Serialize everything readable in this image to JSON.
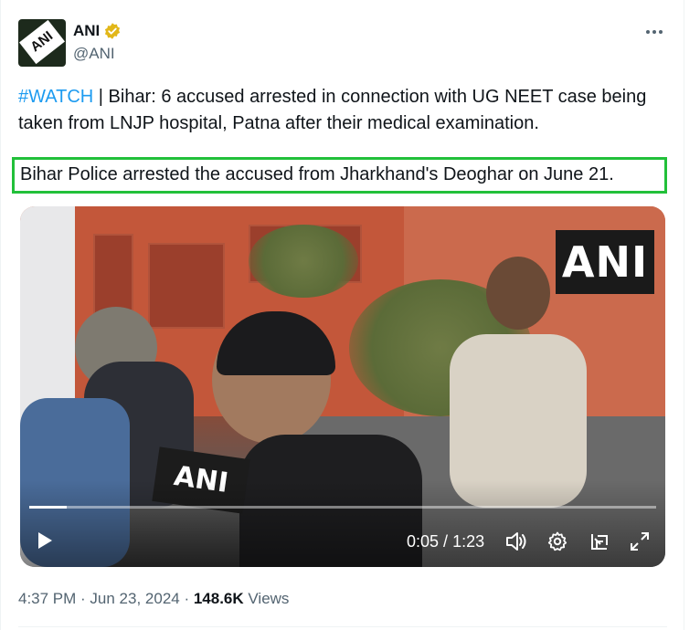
{
  "author": {
    "display_name": "ANI",
    "handle": "@ANI",
    "avatar_text": "ANI",
    "verified": true
  },
  "tweet": {
    "hashtag": "#WATCH",
    "separator": " | ",
    "body": "Bihar: 6 accused arrested in connection with UG NEET case being taken from LNJP hospital, Patna after their medical examination.",
    "highlighted_line": "Bihar Police arrested the accused from Jharkhand's Deoghar on June 21."
  },
  "video": {
    "watermark": "ANI",
    "mic_logo": "ANI",
    "current_time": "0:05",
    "duration": "1:23",
    "time_separator": " / ",
    "progress_fraction": 0.06
  },
  "meta": {
    "time": "4:37 PM",
    "dot1": " · ",
    "date": "Jun 23, 2024",
    "dot2": " · ",
    "views_count": "148.6K",
    "views_label": " Views"
  },
  "colors": {
    "link": "#1d9bf0",
    "highlight_border": "#22c03a",
    "verified_badge": "#e2b719",
    "muted_text": "#536471"
  },
  "icons": [
    "more-icon",
    "verified-badge-icon",
    "play-icon",
    "volume-icon",
    "settings-gear-icon",
    "picture-in-picture-icon",
    "fullscreen-icon"
  ]
}
